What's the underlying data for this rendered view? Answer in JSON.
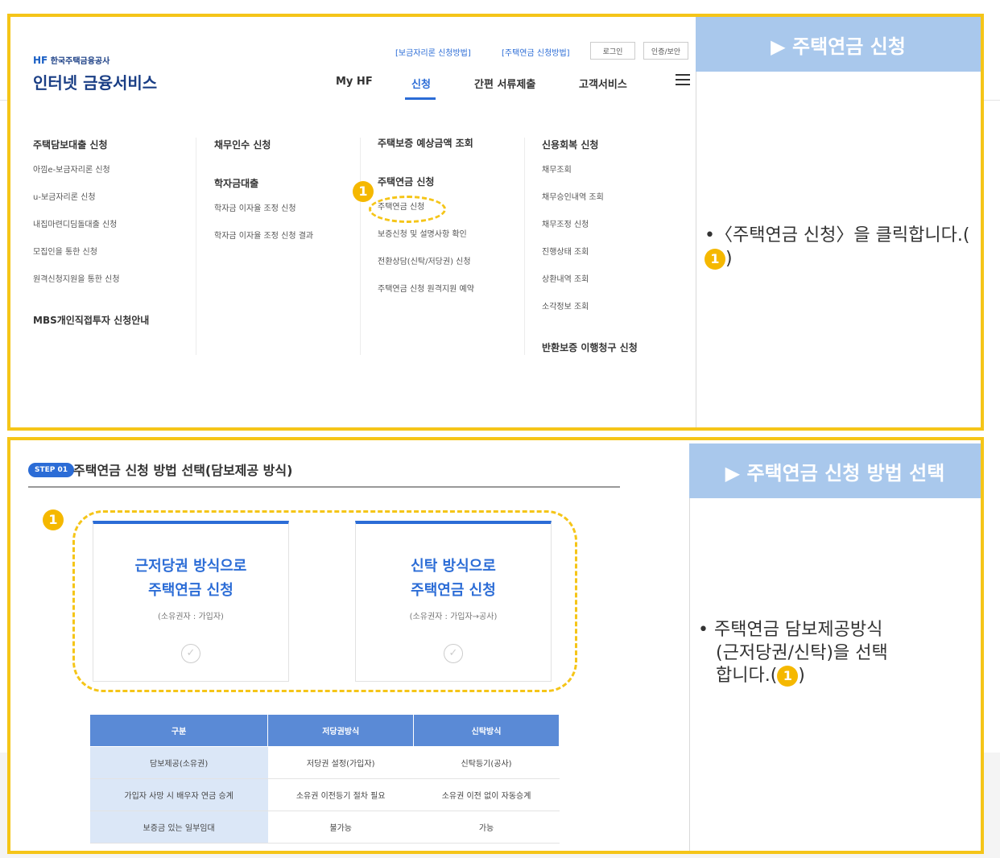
{
  "panel1": {
    "side_title": "▶ 주택연금 신청",
    "instruction": "•〈주택연금 신청〉을 클릭합니다.(",
    "instruction_end": ")",
    "instruction_num": "1",
    "header": {
      "logo_small_hf": "HF",
      "logo_small": "한국주택금융공사",
      "logo_big": "인터넷 금융서비스",
      "top_links": [
        "[보금자리론 신청방법]",
        "[주택연금 신청방법]"
      ],
      "top_buttons": [
        "로그인",
        "인증/보안"
      ],
      "gnb": [
        "My HF",
        "신청",
        "간편 서류제출",
        "고객서비스"
      ]
    },
    "menu": {
      "col1": {
        "heading": "주택담보대출 신청",
        "items": [
          "아낌e-보금자리론 신청",
          "u-보금자리론 신청",
          "내집마련디딤돌대출 신청",
          "모집인을 통한 신청",
          "원격신청지원을 통한 신청"
        ],
        "footer": "MBS개인직접투자 신청안내"
      },
      "col2": {
        "heading1": "채무인수 신청",
        "heading2": "학자금대출",
        "items": [
          "학자금 이자율 조정 신청",
          "학자금 이자율 조정 신청 결과"
        ]
      },
      "col3": {
        "heading1": "주택보증 예상금액 조회",
        "heading2": "주택연금 신청",
        "items": [
          "주택연금 신청",
          "보증신청 및 설명사항 확인",
          "전환상담(신탁/저당권) 신청",
          "주택연금 신청 원격지원 예약"
        ],
        "badge": "1"
      },
      "col4": {
        "heading": "신용회복 신청",
        "items": [
          "채무조회",
          "채무승인내역 조회",
          "채무조정 신청",
          "진행상태 조회",
          "상환내역 조회",
          "소각정보 조회"
        ],
        "footer": "반환보증 이행청구 신청"
      }
    }
  },
  "panel2": {
    "side_title": "▶ 주택연금 신청 방법 선택",
    "instruction_l1": "• 주택연금 담보제공방식",
    "instruction_l2": "(근저당권/신탁)을 선택",
    "instruction_l3": "합니다.(",
    "instruction_end": ")",
    "instruction_num": "1",
    "step_pill": "STEP 01",
    "step_title": "주택연금 신청 방법 선택(담보제공 방식)",
    "badge": "1",
    "cards": [
      {
        "line1": "근저당권 방식으로",
        "line2": "주택연금 신청",
        "sub": "(소유권자 : 가입자)",
        "check": "✓"
      },
      {
        "line1": "신탁 방식으로",
        "line2": "주택연금 신청",
        "sub": "(소유권자 : 가입자→공사)",
        "check": "✓"
      }
    ],
    "table": {
      "headers": [
        "구분",
        "저당권방식",
        "신탁방식"
      ],
      "rows": [
        [
          "담보제공(소유권)",
          "저당권 설정(가입자)",
          "신탁등기(공사)"
        ],
        [
          "가입자 사망 시 배우자 연금 승계",
          "소유권 이전등기 절차 필요",
          "소유권 이전 없이 자동승계"
        ],
        [
          "보증금 있는 일부임대",
          "불가능",
          "가능"
        ]
      ]
    }
  },
  "colors": {
    "highlight_border": "#f5c518",
    "accent_blue": "#2b6cd6",
    "side_title_bg": "#a9c8ec",
    "badge": "#f5b800"
  }
}
